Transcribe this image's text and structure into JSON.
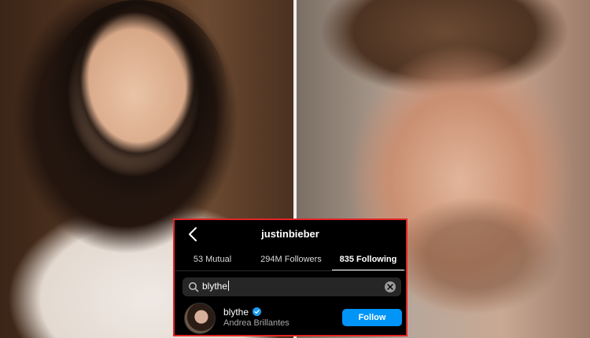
{
  "profile": {
    "username": "justinbieber"
  },
  "tabs": [
    {
      "label": "53 Mutual"
    },
    {
      "label": "294M Followers"
    },
    {
      "label": "835 Following"
    }
  ],
  "search": {
    "value": "blythe"
  },
  "result": {
    "username": "blythe",
    "full_name": "Andrea Brillantes",
    "verified": true,
    "follow_label": "Follow"
  },
  "icons": {
    "back": "chevron-left-icon",
    "search": "search-icon",
    "clear": "clear-icon",
    "verified": "verified-badge-icon"
  },
  "colors": {
    "panel_border": "#e02424",
    "follow_button": "#0095f6",
    "verified_badge": "#1d9bf0"
  }
}
